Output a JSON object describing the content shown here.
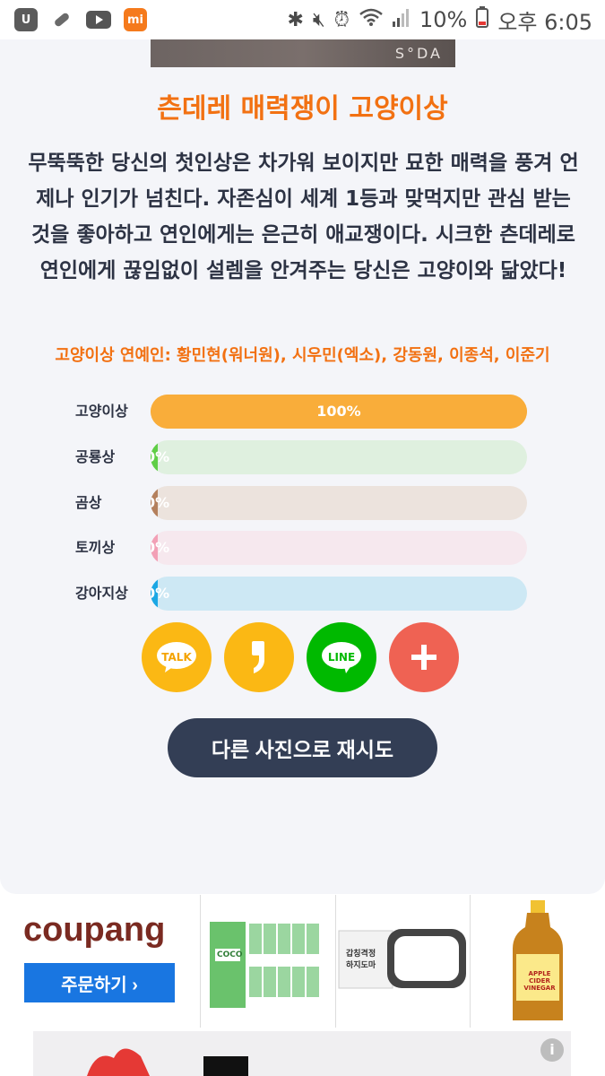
{
  "status_bar": {
    "battery_text": "10%",
    "time_text": "오후 6:05",
    "app_icons": [
      "ucloud-icon",
      "pill-icon",
      "youtube-icon",
      "xiaomi-mi-icon"
    ],
    "system_icons": [
      "bluetooth-icon",
      "mute-icon",
      "alarm-icon",
      "wifi-icon",
      "signal-icon",
      "battery-icon"
    ]
  },
  "photo": {
    "watermark": "S°DA"
  },
  "result": {
    "title": "츤데레 매력쟁이 고양이상",
    "description": "무뚝뚝한 당신의 첫인상은 차가워 보이지만 묘한 매력을 풍겨 언제나 인기가 넘친다. 자존심이 세계 1등과 맞먹지만 관심 받는 것을 좋아하고 연인에게는 은근히 애교쟁이다. 시크한 츤데레로 연인에게 끊임없이 설렘을 안겨주는 당신은 고양이와 닮았다!",
    "celebrities": "고양이상 연예인: 황민현(워너원), 시우민(엑소), 강동원, 이종석, 이준기"
  },
  "scores": [
    {
      "label": "고양이상",
      "percent_text": "100%",
      "value": 100,
      "color": "#f9ad3a",
      "track": "#f9ad3a"
    },
    {
      "label": "공룡상",
      "percent_text": "0%",
      "value": 0,
      "color": "#5fce46",
      "track": "#dff0df"
    },
    {
      "label": "곰상",
      "percent_text": "0%",
      "value": 0,
      "color": "#b4805d",
      "track": "#ece3dd"
    },
    {
      "label": "토끼상",
      "percent_text": "0%",
      "value": 0,
      "color": "#f2a0b6",
      "track": "#f6e8ee"
    },
    {
      "label": "강아지상",
      "percent_text": "0%",
      "value": 0,
      "color": "#1ba7e4",
      "track": "#cde8f4"
    }
  ],
  "share": {
    "kakao_talk": {
      "label": "TALK",
      "color": "#fbb814"
    },
    "kakao_story": {
      "color": "#fbb814"
    },
    "line": {
      "label": "LINE",
      "color": "#00b900"
    },
    "more": {
      "color": "#ef6253"
    }
  },
  "retry_button": "다른 사진으로 재시도",
  "ad": {
    "brand": "coupang",
    "order_button": "주문하기 ›",
    "products": [
      {
        "name": "coconut-water-product",
        "text": "COCO"
      },
      {
        "name": "shoe-dryer-product",
        "text": "갑칭격정 하지도마"
      },
      {
        "name": "apple-cider-vinegar-product",
        "text": "APPLE CIDER VINEGAR"
      }
    ]
  }
}
